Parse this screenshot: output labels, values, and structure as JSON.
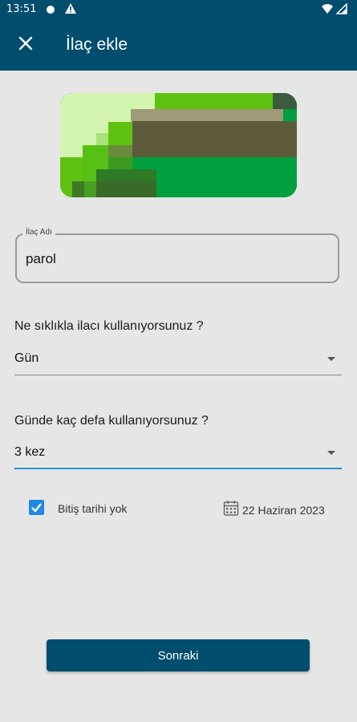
{
  "status_bar": {
    "time": "13:51",
    "icons": [
      "notification-dot-icon",
      "warning-icon",
      "wifi-icon",
      "signal-icon"
    ]
  },
  "app_bar": {
    "title": "İlaç ekle",
    "close_icon": "close-icon"
  },
  "form": {
    "name_field": {
      "label": "İlaç Adı",
      "value": "parol"
    },
    "frequency": {
      "question": "Ne sıklıkla ilacı kullanıyorsunuz ?",
      "selected": "Gün"
    },
    "times_per_day": {
      "question": "Günde kaç defa kullanıyorsunuz ?",
      "selected": "3 kez"
    },
    "end_date": {
      "checkbox_label": "Bitiş tarihi yok",
      "checked": true,
      "date": "22 Haziran 2023",
      "icon": "calendar-icon"
    }
  },
  "next_button": {
    "label": "Sonraki"
  },
  "colors": {
    "primary": "#004d6e",
    "accent": "#1e88e5",
    "background": "#e6e6e6"
  }
}
